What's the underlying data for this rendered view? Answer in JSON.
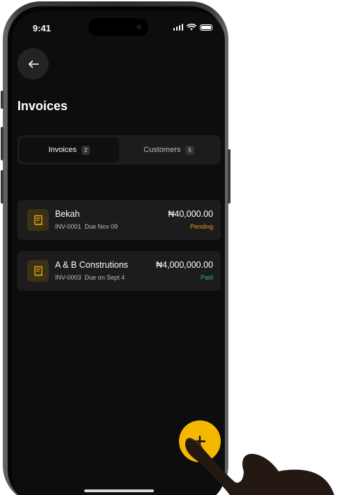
{
  "status_bar": {
    "time": "9:41",
    "icons": [
      "cellular-signal-icon",
      "wifi-icon",
      "battery-icon"
    ]
  },
  "header": {
    "back_icon": "arrow-left-icon",
    "title": "Invoices"
  },
  "tabs": [
    {
      "label": "Invoices",
      "count": "2",
      "active": true
    },
    {
      "label": "Customers",
      "count": "5",
      "active": false
    }
  ],
  "invoices": [
    {
      "name": "Bekah",
      "number": "INV-0001",
      "due": "Due Nov 09",
      "amount": "₦40,000.00",
      "status": "Pending",
      "status_color": "#e89a1c",
      "icon": "receipt-icon"
    },
    {
      "name": "A & B Construtions",
      "number": "INV-0003",
      "due": "Due on Sept 4",
      "amount": "₦4,000,000.00",
      "status": "Paid",
      "status_color": "#2bb673",
      "icon": "receipt-icon"
    }
  ],
  "fab": {
    "icon": "plus-icon"
  },
  "colors": {
    "accent": "#f5b800",
    "background": "#0d0d0d",
    "card": "#1c1c1c"
  }
}
